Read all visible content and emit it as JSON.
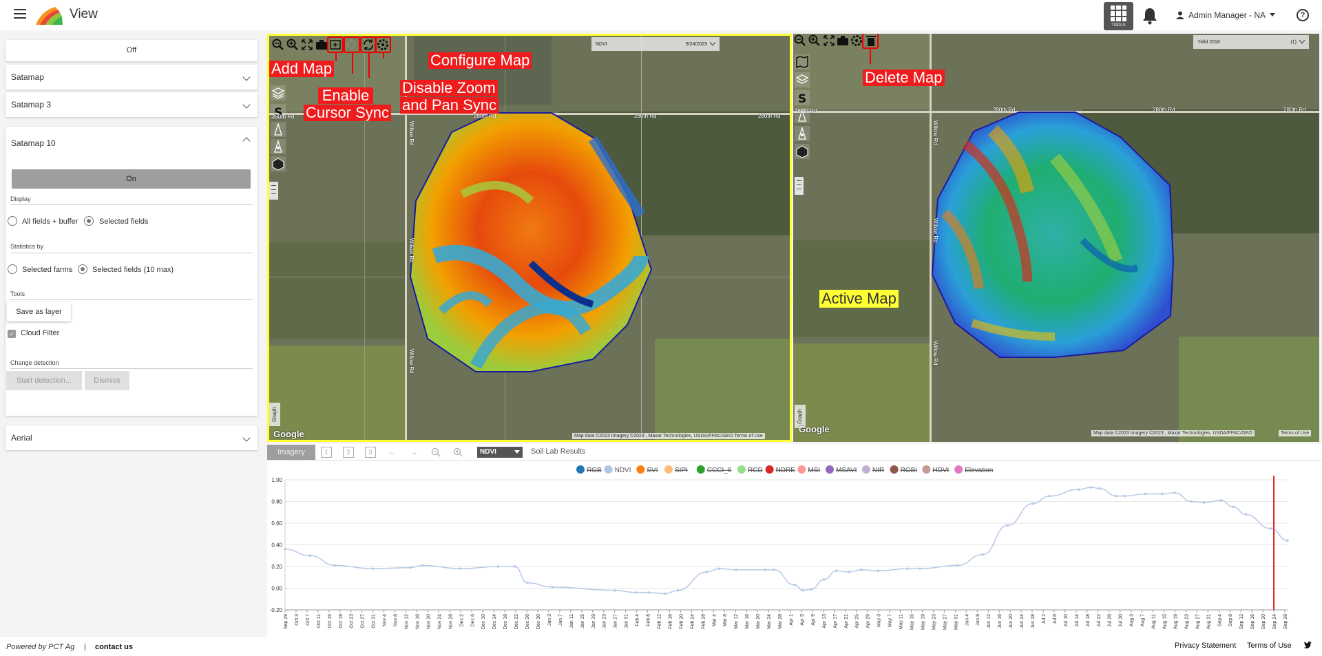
{
  "header": {
    "app_title": "View",
    "tools_label": "TOOLS",
    "user_label": "Admin Manager - NA",
    "help_glyph": "?"
  },
  "sidebar": {
    "off_label": "Off",
    "sections": [
      {
        "label": "Satamap"
      },
      {
        "label": "Satamap 3"
      },
      {
        "label": "Satamap 10"
      },
      {
        "label": "Aerial"
      }
    ],
    "on_label": "On",
    "display_label": "Display",
    "display_options": [
      "All fields + buffer",
      "Selected fields"
    ],
    "stats_label": "Statistics by",
    "stats_options": [
      "Selected farms",
      "Selected fields (10 max)"
    ],
    "tools_label": "Tools",
    "save_layer_label": "Save as layer",
    "cloud_filter_label": "Cloud Filter",
    "change_detection_label": "Change detection",
    "start_detection_label": "Start detection...",
    "dismiss_label": "Dismiss"
  },
  "maps": {
    "left": {
      "layer": "NDVI",
      "date": "9/24/2023",
      "google": "Google",
      "attribution": "Map data ©2023 Imagery ©2023 , Maxar Technologies, USDA/FPAC/GEO   Terms of Use",
      "graph_tab": "Graph"
    },
    "right": {
      "layer": "Yield 2018",
      "count": "(1)",
      "google": "Google",
      "attribution": "Map data ©2023 Imagery ©2023 , Maxar Technologies, USDA/FPAC/GEO",
      "terms": "Terms of Use",
      "graph_tab": "Graph"
    },
    "roads": {
      "h": "280th Rd",
      "v": "Willow Rd"
    }
  },
  "annotations": {
    "add_map": "Add  Map",
    "enable_sync": [
      "Enable",
      "Cursor Sync"
    ],
    "disable_zoom": [
      "Disable Zoom",
      "and Pan Sync"
    ],
    "configure_map": "Configure Map",
    "delete_map": "Delete Map",
    "active_map": "Active Map"
  },
  "graph_toolbar": {
    "imagery_tab": "Imagery",
    "index_select": "NDVI",
    "soil_tab": "Soil Lab Results"
  },
  "chart_data": {
    "type": "line",
    "ylim": [
      -0.2,
      1.0
    ],
    "yticks": [
      "1.00",
      "0.80",
      "0.60",
      "0.40",
      "0.20",
      "0.00",
      "-0.20"
    ],
    "legend": [
      {
        "name": "RGB",
        "color": "#1f77b4",
        "struck": true
      },
      {
        "name": "NDVI",
        "color": "#aec7e8",
        "struck": false
      },
      {
        "name": "SVI",
        "color": "#ff7f0e",
        "struck": true
      },
      {
        "name": "SIPI",
        "color": "#ffbb78",
        "struck": true
      },
      {
        "name": "CCCI_6",
        "color": "#2ca02c",
        "struck": true
      },
      {
        "name": "RCD",
        "color": "#98df8a",
        "struck": true
      },
      {
        "name": "NDRE",
        "color": "#d62728",
        "struck": true
      },
      {
        "name": "MSI",
        "color": "#ff9896",
        "struck": true
      },
      {
        "name": "MSAVI",
        "color": "#9467bd",
        "struck": true
      },
      {
        "name": "NIR",
        "color": "#c5b0d5",
        "struck": true
      },
      {
        "name": "RGBI",
        "color": "#8c564b",
        "struck": true
      },
      {
        "name": "HDVI",
        "color": "#c49c94",
        "struck": true
      },
      {
        "name": "Elevation",
        "color": "#e377c2",
        "struck": true
      }
    ],
    "x_labels": [
      "Sep 29",
      "Oct 3",
      "Oct 7",
      "Oct 11",
      "Oct 15",
      "Oct 19",
      "Oct 23",
      "Oct 27",
      "Oct 31",
      "Nov 4",
      "Nov 8",
      "Nov 12",
      "Nov 16",
      "Nov 20",
      "Nov 24",
      "Nov 28",
      "Dec 2",
      "Dec 6",
      "Dec 10",
      "Dec 14",
      "Dec 18",
      "Dec 22",
      "Dec 26",
      "Dec 30",
      "Jan 3",
      "Jan 7",
      "Jan 11",
      "Jan 15",
      "Jan 19",
      "Jan 23",
      "Jan 27",
      "Jan 31",
      "Feb 4",
      "Feb 8",
      "Feb 12",
      "Feb 16",
      "Feb 20",
      "Feb 24",
      "Feb 28",
      "Mar 4",
      "Mar 8",
      "Mar 12",
      "Mar 16",
      "Mar 20",
      "Mar 24",
      "Mar 28",
      "Apr 1",
      "Apr 5",
      "Apr 9",
      "Apr 13",
      "Apr 17",
      "Apr 21",
      "Apr 25",
      "Apr 29",
      "May 3",
      "May 7",
      "May 11",
      "May 15",
      "May 19",
      "May 23",
      "May 27",
      "May 31",
      "Jun 4",
      "Jun 8",
      "Jun 12",
      "Jun 16",
      "Jun 20",
      "Jun 24",
      "Jun 28",
      "Jul 2",
      "Jul 6",
      "Jul 10",
      "Jul 14",
      "Jul 18",
      "Jul 22",
      "Jul 26",
      "Jul 30",
      "Aug 3",
      "Aug 7",
      "Aug 11",
      "Aug 15",
      "Aug 19",
      "Aug 23",
      "Aug 27",
      "Aug 31",
      "Sep 4",
      "Sep 8",
      "Sep 12",
      "Sep 16",
      "Sep 20",
      "Sep 24",
      "Sep 28"
    ],
    "series": [
      {
        "name": "NDVI",
        "color": "#b7c9e6",
        "points": [
          [
            0,
            0.36
          ],
          [
            6,
            0.3
          ],
          [
            12,
            0.21
          ],
          [
            21,
            0.18
          ],
          [
            30,
            0.19
          ],
          [
            33,
            0.21
          ],
          [
            42,
            0.18
          ],
          [
            51,
            0.2
          ],
          [
            55,
            0.2
          ],
          [
            58,
            0.05
          ],
          [
            64,
            0.01
          ],
          [
            79,
            -0.02
          ],
          [
            84,
            -0.04
          ],
          [
            87,
            -0.04
          ],
          [
            91,
            -0.05
          ],
          [
            94,
            -0.02
          ],
          [
            101,
            0.15
          ],
          [
            104,
            0.18
          ],
          [
            108,
            0.17
          ],
          [
            115,
            0.17
          ],
          [
            117,
            0.17
          ],
          [
            122,
            0.03
          ],
          [
            124,
            -0.02
          ],
          [
            126,
            -0.01
          ],
          [
            129,
            0.08
          ],
          [
            132,
            0.16
          ],
          [
            135,
            0.15
          ],
          [
            138,
            0.17
          ],
          [
            142,
            0.16
          ],
          [
            149,
            0.18
          ],
          [
            152,
            0.18
          ],
          [
            161,
            0.21
          ],
          [
            167,
            0.31
          ],
          [
            173,
            0.58
          ],
          [
            179,
            0.78
          ],
          [
            183,
            0.85
          ],
          [
            190,
            0.91
          ],
          [
            193,
            0.93
          ],
          [
            195,
            0.92
          ],
          [
            199,
            0.85
          ],
          [
            201,
            0.85
          ],
          [
            206,
            0.87
          ],
          [
            210,
            0.87
          ],
          [
            213,
            0.88
          ],
          [
            217,
            0.8
          ],
          [
            220,
            0.79
          ],
          [
            224,
            0.81
          ],
          [
            227,
            0.75
          ],
          [
            230,
            0.68
          ],
          [
            236,
            0.55
          ],
          [
            240,
            0.44
          ]
        ]
      }
    ],
    "x_range_days": [
      0,
      365
    ],
    "marker_day": 360
  },
  "footer": {
    "powered_by": "Powered by PCT Ag",
    "separator": "|",
    "contact": "contact us",
    "privacy": "Privacy Statement",
    "terms": "Terms of Use"
  }
}
